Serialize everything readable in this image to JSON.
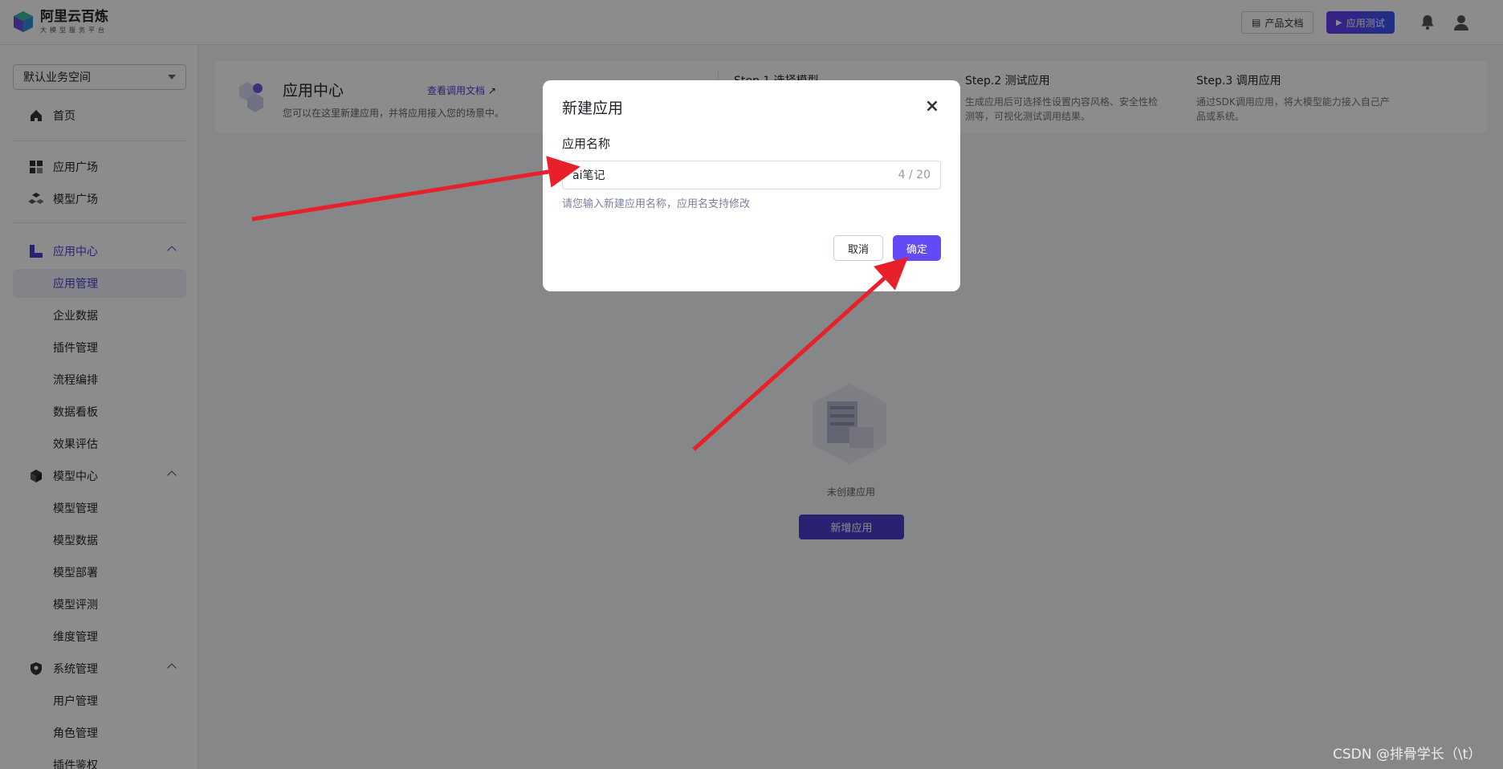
{
  "header": {
    "brand_title": "阿里云百炼",
    "brand_subtitle": "大模型服务平台",
    "docs_label": "产品文档",
    "test_label": "应用测试"
  },
  "sidebar": {
    "workspace": "默认业务空间",
    "home": "首页",
    "app_plaza": "应用广场",
    "model_plaza": "模型广场",
    "app_center": "应用中心",
    "app_center_items": [
      "应用管理",
      "企业数据",
      "插件管理",
      "流程编排",
      "数据看板",
      "效果评估"
    ],
    "model_center": "模型中心",
    "model_center_items": [
      "模型管理",
      "模型数据",
      "模型部署",
      "模型评测",
      "维度管理"
    ],
    "system_mgmt": "系统管理",
    "system_items": [
      "用户管理",
      "角色管理",
      "插件鉴权"
    ]
  },
  "banner": {
    "title": "应用中心",
    "desc": "您可以在这里新建应用，并将应用接入您的场景中。",
    "link": "查看调用文档",
    "steps": [
      {
        "title": "Step.1 选择模型",
        "desc": ""
      },
      {
        "title": "Step.2 测试应用",
        "desc": "生成应用后可选择性设置内容风格、安全性检测等，可视化测试调用结果。"
      },
      {
        "title": "Step.3 调用应用",
        "desc": "通过SDK调用应用，将大模型能力接入自己产品或系统。"
      }
    ]
  },
  "empty": {
    "text": "未创建应用",
    "button": "新增应用"
  },
  "modal": {
    "title": "新建应用",
    "field_label": "应用名称",
    "input_value": "ai笔记",
    "counter": "4 / 20",
    "help": "请您输入新建应用名称，应用名支持修改",
    "cancel": "取消",
    "ok": "确定"
  },
  "watermark": "CSDN @排骨学长（\\t）",
  "colors": {
    "accent": "#4b3fd1",
    "ok_button": "#624bf5",
    "arrow": "#e8202a"
  }
}
